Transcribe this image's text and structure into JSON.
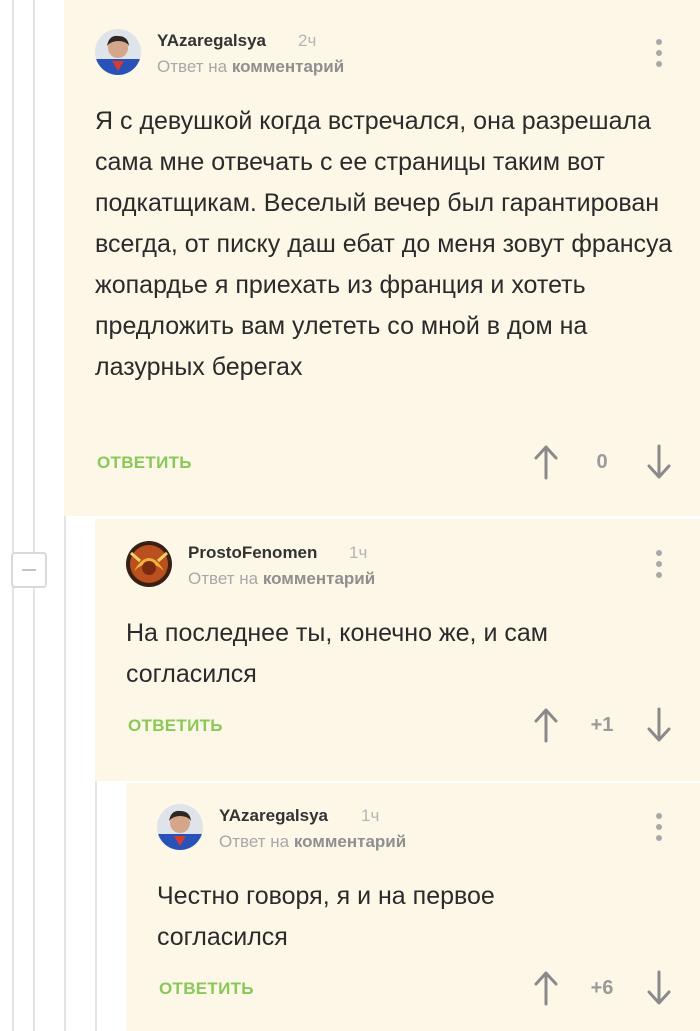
{
  "comments": [
    {
      "username": "YAzaregalsya",
      "timestamp": "2ч",
      "reply_prefix": "Ответ на",
      "reply_target": "комментарий",
      "text": "Я с девушкой когда встречался, она разрешала сама мне отвечать с ее страницы таким вот подкатщикам. Веселый вечер был гарантирован всегда, от писку даш ебат до меня зовут франсуа жопардье я приехать из франция и хотеть предложить вам улететь со мной в дом на лазурных берегах",
      "reply_label": "ОТВЕТИТЬ",
      "rating": "0"
    },
    {
      "username": "ProstoFenomen",
      "timestamp": "1ч",
      "reply_prefix": "Ответ на",
      "reply_target": "комментарий",
      "text": "На последнее ты, конечно же, и сам согласился",
      "reply_label": "ОТВЕТИТЬ",
      "rating": "+1"
    },
    {
      "username": "YAzaregalsya",
      "timestamp": "1ч",
      "reply_prefix": "Ответ на",
      "reply_target": "комментарий",
      "text": "Честно говоря, я и на первое согласился",
      "reply_label": "ОТВЕТИТЬ",
      "rating": "+6"
    }
  ],
  "icons": {
    "more": "more-vertical-icon",
    "upvote": "arrow-up-icon",
    "downvote": "arrow-down-icon",
    "collapse": "minus-icon"
  },
  "colors": {
    "comment_bg": "#fcf7e7",
    "reply_action": "#8ac858",
    "thread_line": "#e4e4e4"
  }
}
